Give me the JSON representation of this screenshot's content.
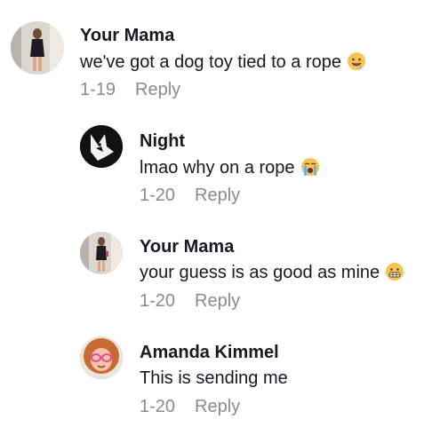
{
  "comments": [
    {
      "author": "Your Mama",
      "text": "we've got a dog toy tied to a rope",
      "emoji": "drooling-face-emoji",
      "date": "1-19",
      "reply_label": "Reply"
    },
    {
      "author": "Night",
      "text": "lmao why on a rope",
      "emoji": "loudly-crying-face-emoji",
      "date": "1-20",
      "reply_label": "Reply"
    },
    {
      "author": "Your Mama",
      "text": "your guess is as good as mine",
      "emoji": "grimacing-face-emoji",
      "date": "1-20",
      "reply_label": "Reply"
    },
    {
      "author": "Amanda Kimmel",
      "text": "This is sending me",
      "emoji": "",
      "date": "1-20",
      "reply_label": "Reply"
    }
  ],
  "colors": {
    "text": "#161823",
    "secondary": "#8a8b91",
    "background": "#ffffff"
  }
}
